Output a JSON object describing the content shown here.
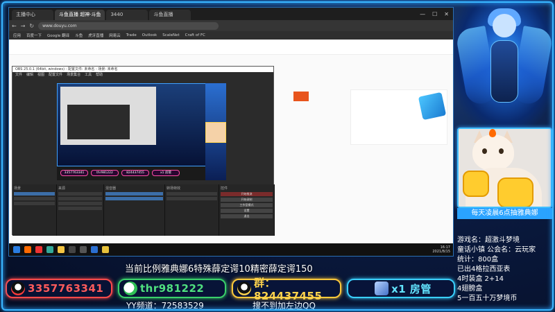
{
  "browser": {
    "tabs": [
      "主播中心",
      "斗鱼直播 超神·斗鱼",
      "3440",
      "斗鱼直播"
    ],
    "address": "www.douyu.com",
    "bookmarks": [
      "应用",
      "百度一下",
      "Google 翻译",
      "斗鱼",
      "虎牙直播",
      "网易云",
      "Trade",
      "Outlook",
      "ScaleNet",
      "Craft of FC"
    ]
  },
  "obs": {
    "title": "OBS 25.0.1 (64bit, windows) - 配置文件: 未命名 - 场景: 未命名",
    "menu": [
      "文件",
      "编辑",
      "视图",
      "配置文件",
      "场景集合",
      "工具",
      "帮助"
    ],
    "docks": {
      "scenes": "场景",
      "sources": "来源",
      "mixer": "混音器",
      "transitions": "转场特效",
      "controls": "控件"
    },
    "control_buttons": [
      "开始推流",
      "开始录制",
      "工作室模式",
      "设置",
      "退出"
    ],
    "mini_badges": [
      "3357763341",
      "thr981222",
      "824437455",
      "x1 房管"
    ]
  },
  "taskbar": {
    "time": "16:17",
    "date": "2021/8/15"
  },
  "cat_caption": "每天凌晨6点抽雅典娜",
  "info_lines": [
    "游戏名：超激斗梦境",
    "童话小镇 公会名：云玩家",
    "统计：800盒",
    "已出4格拉西亚表",
    "4时装盒 2+14",
    "4翅膀盒",
    "5一百五十万梦境币"
  ],
  "marquee": "当前比例雅典娜6特殊薛定谔10精密薛定谔150",
  "contacts": {
    "qq": "3357763341",
    "wechat": "thr981222",
    "group": "群：824437455",
    "manager": "x1 房管"
  },
  "yy_channel": "YY频道：72583529",
  "search_hint": "搜不到加左边QQ",
  "colors": {
    "frame": "#39b6ff",
    "qq": "#ff5b5b",
    "wechat": "#4fe07f",
    "group": "#ffd34d",
    "manager": "#62e5ff"
  }
}
